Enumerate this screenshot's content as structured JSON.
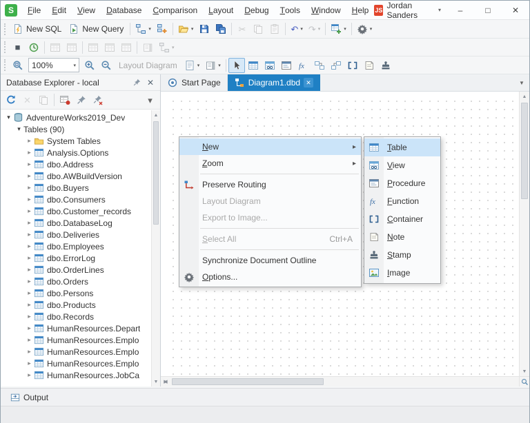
{
  "colors": {
    "accent_blue": "#1f80c4",
    "menu_highlight": "#cbe4f9",
    "badge_red": "#e2452c",
    "logo_green": "#3db04a",
    "disabled_text": "#a9a9a9"
  },
  "titlebar": {
    "app_letter": "S",
    "menus": [
      {
        "label": "File",
        "ul": 0
      },
      {
        "label": "Edit",
        "ul": 0
      },
      {
        "label": "View",
        "ul": 0
      },
      {
        "label": "Database",
        "ul": 0
      },
      {
        "label": "Comparison",
        "ul": 0
      },
      {
        "label": "Layout",
        "ul": 0
      },
      {
        "label": "Debug",
        "ul": 0
      },
      {
        "label": "Tools",
        "ul": 0
      },
      {
        "label": "Window",
        "ul": 0
      },
      {
        "label": "Help",
        "ul": 0
      }
    ],
    "user": {
      "initials": "JS",
      "name": "Jordan Sanders"
    },
    "controls": {
      "minimize": "–",
      "maximize": "□",
      "close": "✕"
    }
  },
  "toolbars": {
    "row1": [
      {
        "t": "grip"
      },
      {
        "t": "btn",
        "name": "new-sql",
        "icon": "doc-sql",
        "label": "New SQL"
      },
      {
        "t": "btn",
        "name": "new-query",
        "icon": "doc-query",
        "label": "New Query"
      },
      {
        "t": "sep"
      },
      {
        "t": "btn",
        "name": "new-diagram",
        "icon": "diagram",
        "dd": true
      },
      {
        "t": "btn",
        "name": "add-diagram-object",
        "icon": "diagram-add"
      },
      {
        "t": "sep"
      },
      {
        "t": "btn",
        "name": "open-file",
        "icon": "folder-open",
        "dd": true
      },
      {
        "t": "btn",
        "name": "save",
        "icon": "floppy"
      },
      {
        "t": "btn",
        "name": "save-all",
        "icon": "floppy-all"
      },
      {
        "t": "sep"
      },
      {
        "t": "btn",
        "name": "cut",
        "glyph": "✂",
        "color": "#8a8f94",
        "disabled": true
      },
      {
        "t": "btn",
        "name": "copy",
        "icon": "copy",
        "disabled": true
      },
      {
        "t": "btn",
        "name": "paste",
        "icon": "clipboard",
        "disabled": true
      },
      {
        "t": "sep"
      },
      {
        "t": "btn",
        "name": "undo",
        "glyph": "↶",
        "color": "#4a5fc1",
        "dd": true
      },
      {
        "t": "btn",
        "name": "redo",
        "glyph": "↷",
        "color": "#6a7fb0",
        "dd": true,
        "disabled": true
      },
      {
        "t": "sep"
      },
      {
        "t": "btn",
        "name": "new-object",
        "icon": "table-add",
        "dd": true
      },
      {
        "t": "sep"
      },
      {
        "t": "btn",
        "name": "more-tools",
        "icon": "gear",
        "dd": true
      }
    ],
    "row2": [
      {
        "t": "grip"
      },
      {
        "t": "btn",
        "name": "stop",
        "glyph": "■",
        "color": "#515a63"
      },
      {
        "t": "btn",
        "name": "query-history",
        "icon": "clock"
      },
      {
        "t": "sep"
      },
      {
        "t": "btn",
        "name": "edit-data",
        "icon": "grid-gray",
        "disabled": true
      },
      {
        "t": "btn",
        "name": "retrieve-data",
        "icon": "grid-gray",
        "disabled": true
      },
      {
        "t": "sep"
      },
      {
        "t": "btn",
        "name": "grid-view",
        "icon": "grid-gray",
        "disabled": true
      },
      {
        "t": "btn",
        "name": "card-view",
        "icon": "grid-gray",
        "disabled": true
      },
      {
        "t": "btn",
        "name": "report-view",
        "icon": "grid-gray",
        "disabled": true
      },
      {
        "t": "sep"
      },
      {
        "t": "btn",
        "name": "pages",
        "icon": "pages",
        "disabled": true
      },
      {
        "t": "btn",
        "name": "diagram-options",
        "icon": "diagram",
        "dd": true,
        "disabled": true
      }
    ],
    "row3": [
      {
        "t": "grip"
      },
      {
        "t": "btn",
        "name": "zoom-fit",
        "icon": "zoom-fit"
      },
      {
        "t": "combo",
        "name": "zoom-level",
        "value": "100%"
      },
      {
        "t": "btn",
        "name": "zoom-in",
        "icon": "zoom-in"
      },
      {
        "t": "btn",
        "name": "zoom-out",
        "icon": "zoom-out"
      },
      {
        "t": "label",
        "name": "layout-diagram",
        "label": "Layout Diagram",
        "disabled": true
      },
      {
        "t": "btn",
        "name": "page-setup",
        "icon": "page",
        "dd": true
      },
      {
        "t": "btn",
        "name": "print-preview",
        "icon": "pages",
        "dd": true
      },
      {
        "t": "sep"
      },
      {
        "t": "btn",
        "name": "pointer-tool",
        "icon": "cursor",
        "active": true
      },
      {
        "t": "btn",
        "name": "table-tool",
        "icon": "table"
      },
      {
        "t": "btn",
        "name": "view-tool",
        "icon": "view"
      },
      {
        "t": "btn",
        "name": "procedure-tool",
        "icon": "procedure"
      },
      {
        "t": "btn",
        "name": "function-tool",
        "icon": "fx"
      },
      {
        "t": "btn",
        "name": "relation-tool",
        "icon": "relation"
      },
      {
        "t": "btn",
        "name": "self-relation-tool",
        "icon": "relation2"
      },
      {
        "t": "btn",
        "name": "container-tool",
        "icon": "container"
      },
      {
        "t": "btn",
        "name": "note-tool",
        "icon": "note"
      },
      {
        "t": "btn",
        "name": "stamp-tool",
        "icon": "stamp"
      }
    ]
  },
  "explorer": {
    "title": "Database Explorer - local",
    "toolbar": [
      {
        "t": "btn",
        "name": "refresh",
        "icon": "refresh"
      },
      {
        "t": "btn",
        "name": "stop-refresh",
        "glyph": "✕",
        "color": "#a9aeb4",
        "disabled": true
      },
      {
        "t": "btn",
        "name": "duplicate-object",
        "icon": "copy",
        "disabled": true
      },
      {
        "t": "sep"
      },
      {
        "t": "btn",
        "name": "pin-table",
        "icon": "table-pin"
      },
      {
        "t": "btn",
        "name": "pin",
        "icon": "pin"
      },
      {
        "t": "btn",
        "name": "unpin-all",
        "icon": "pin-x"
      },
      {
        "t": "space"
      },
      {
        "t": "btn",
        "name": "toolbar-overflow",
        "glyph": "▾",
        "color": "#666"
      }
    ],
    "tree": [
      {
        "indent": 0,
        "caret": "open",
        "icon": "database",
        "label": "AdventureWorks2019_Dev"
      },
      {
        "indent": 1,
        "caret": "open",
        "icon": null,
        "label": "Tables (90)"
      },
      {
        "indent": 2,
        "caret": "closed",
        "icon": "folder",
        "label": "System Tables"
      },
      {
        "indent": 2,
        "caret": "closed",
        "icon": "table",
        "label": "Analysis.Options"
      },
      {
        "indent": 2,
        "caret": "closed",
        "icon": "table",
        "label": "dbo.Address"
      },
      {
        "indent": 2,
        "caret": "closed",
        "icon": "table",
        "label": "dbo.AWBuildVersion"
      },
      {
        "indent": 2,
        "caret": "closed",
        "icon": "table",
        "label": "dbo.Buyers"
      },
      {
        "indent": 2,
        "caret": "closed",
        "icon": "table",
        "label": "dbo.Consumers"
      },
      {
        "indent": 2,
        "caret": "closed",
        "icon": "table",
        "label": "dbo.Customer_records"
      },
      {
        "indent": 2,
        "caret": "closed",
        "icon": "table",
        "label": "dbo.DatabaseLog"
      },
      {
        "indent": 2,
        "caret": "closed",
        "icon": "table",
        "label": "dbo.Deliveries"
      },
      {
        "indent": 2,
        "caret": "closed",
        "icon": "table",
        "label": "dbo.Employees"
      },
      {
        "indent": 2,
        "caret": "closed",
        "icon": "table",
        "label": "dbo.ErrorLog"
      },
      {
        "indent": 2,
        "caret": "closed",
        "icon": "table",
        "label": "dbo.OrderLines"
      },
      {
        "indent": 2,
        "caret": "closed",
        "icon": "table",
        "label": "dbo.Orders"
      },
      {
        "indent": 2,
        "caret": "closed",
        "icon": "table",
        "label": "dbo.Persons"
      },
      {
        "indent": 2,
        "caret": "closed",
        "icon": "table",
        "label": "dbo.Products"
      },
      {
        "indent": 2,
        "caret": "closed",
        "icon": "table",
        "label": "dbo.Records"
      },
      {
        "indent": 2,
        "caret": "closed",
        "icon": "table",
        "label": "HumanResources.Depart"
      },
      {
        "indent": 2,
        "caret": "closed",
        "icon": "table",
        "label": "HumanResources.Emplo"
      },
      {
        "indent": 2,
        "caret": "closed",
        "icon": "table",
        "label": "HumanResources.Emplo"
      },
      {
        "indent": 2,
        "caret": "closed",
        "icon": "table",
        "label": "HumanResources.Emplo"
      },
      {
        "indent": 2,
        "caret": "closed",
        "icon": "table",
        "label": "HumanResources.JobCa"
      }
    ]
  },
  "editor": {
    "tabs": [
      {
        "label": "Start Page",
        "icon": "start",
        "active": false,
        "close": false
      },
      {
        "label": "Diagram1.dbd",
        "icon": "diagram-tab",
        "active": true,
        "close": true
      }
    ]
  },
  "context_menu": {
    "items": [
      {
        "label": "New",
        "ul": 0,
        "submenu": true,
        "highlighted": true
      },
      {
        "label": "Zoom",
        "ul": 0,
        "submenu": true
      },
      {
        "sep": true
      },
      {
        "label": "Preserve Routing",
        "ul": -1,
        "icon": "routing"
      },
      {
        "label": "Layout Diagram",
        "ul": -1,
        "disabled": true
      },
      {
        "label": "Export to Image...",
        "ul": -1,
        "disabled": true
      },
      {
        "sep": true
      },
      {
        "label": "Select All",
        "ul": 0,
        "disabled": true,
        "shortcut": "Ctrl+A"
      },
      {
        "sep": true
      },
      {
        "label": "Synchronize Document Outline",
        "ul": -1
      },
      {
        "label": "Options...",
        "ul": 0,
        "icon": "gear"
      }
    ]
  },
  "submenu": {
    "items": [
      {
        "label": "Table",
        "ul": 0,
        "icon": "table",
        "highlighted": true
      },
      {
        "label": "View",
        "ul": 0,
        "icon": "view"
      },
      {
        "label": "Procedure",
        "ul": 0,
        "icon": "procedure"
      },
      {
        "label": "Function",
        "ul": 0,
        "icon": "fx"
      },
      {
        "label": "Container",
        "ul": 0,
        "icon": "container"
      },
      {
        "label": "Note",
        "ul": 0,
        "icon": "note"
      },
      {
        "label": "Stamp",
        "ul": 0,
        "icon": "stamp"
      },
      {
        "label": "Image",
        "ul": 0,
        "icon": "image"
      }
    ]
  },
  "output": {
    "label": "Output"
  }
}
